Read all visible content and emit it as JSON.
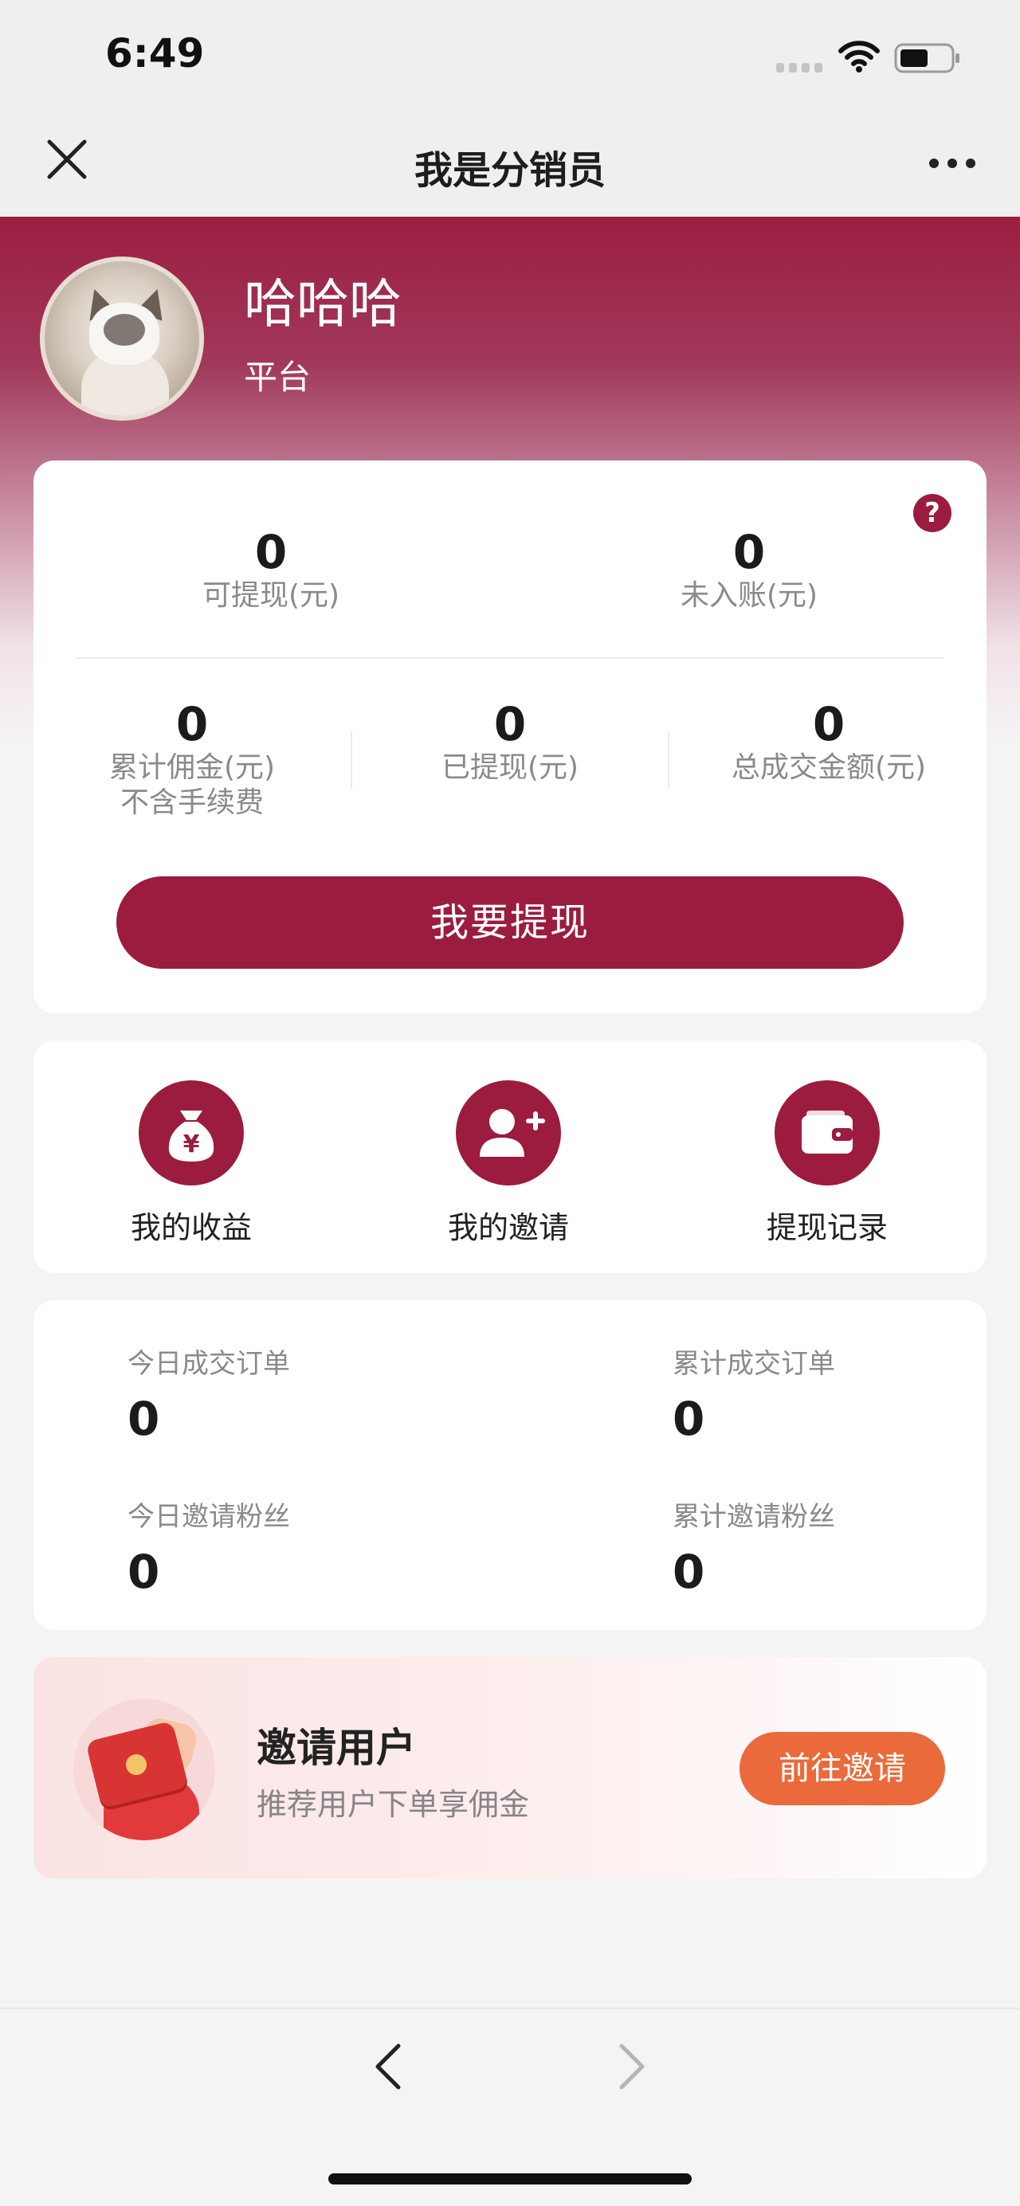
{
  "status_bar": {
    "time": "6:49"
  },
  "nav": {
    "title": "我是分销员"
  },
  "profile": {
    "name": "哈哈哈",
    "role": "平台"
  },
  "help_icon_text": "?",
  "balance": {
    "withdrawable_value": "0",
    "withdrawable_label": "可提现(元)",
    "pending_value": "0",
    "pending_label": "未入账(元)",
    "total_commission_value": "0",
    "total_commission_label": "累计佣金(元)",
    "total_commission_note": "不含手续费",
    "withdrawn_value": "0",
    "withdrawn_label": "已提现(元)",
    "total_volume_value": "0",
    "total_volume_label": "总成交金额(元)",
    "withdraw_button": "我要提现"
  },
  "actions": [
    {
      "label": "我的收益",
      "icon": "money-bag-icon"
    },
    {
      "label": "我的邀请",
      "icon": "add-user-icon"
    },
    {
      "label": "提现记录",
      "icon": "wallet-icon"
    }
  ],
  "orders": {
    "today_orders_label": "今日成交订单",
    "today_orders_value": "0",
    "total_orders_label": "累计成交订单",
    "total_orders_value": "0",
    "today_fans_label": "今日邀请粉丝",
    "today_fans_value": "0",
    "total_fans_label": "累计邀请粉丝",
    "total_fans_value": "0"
  },
  "invite": {
    "title": "邀请用户",
    "subtitle": "推荐用户下单享佣金",
    "button": "前往邀请"
  },
  "colors": {
    "brand": "#9b1c3e",
    "invite_button": "#ea6a3b",
    "background": "#f4f4f5"
  }
}
